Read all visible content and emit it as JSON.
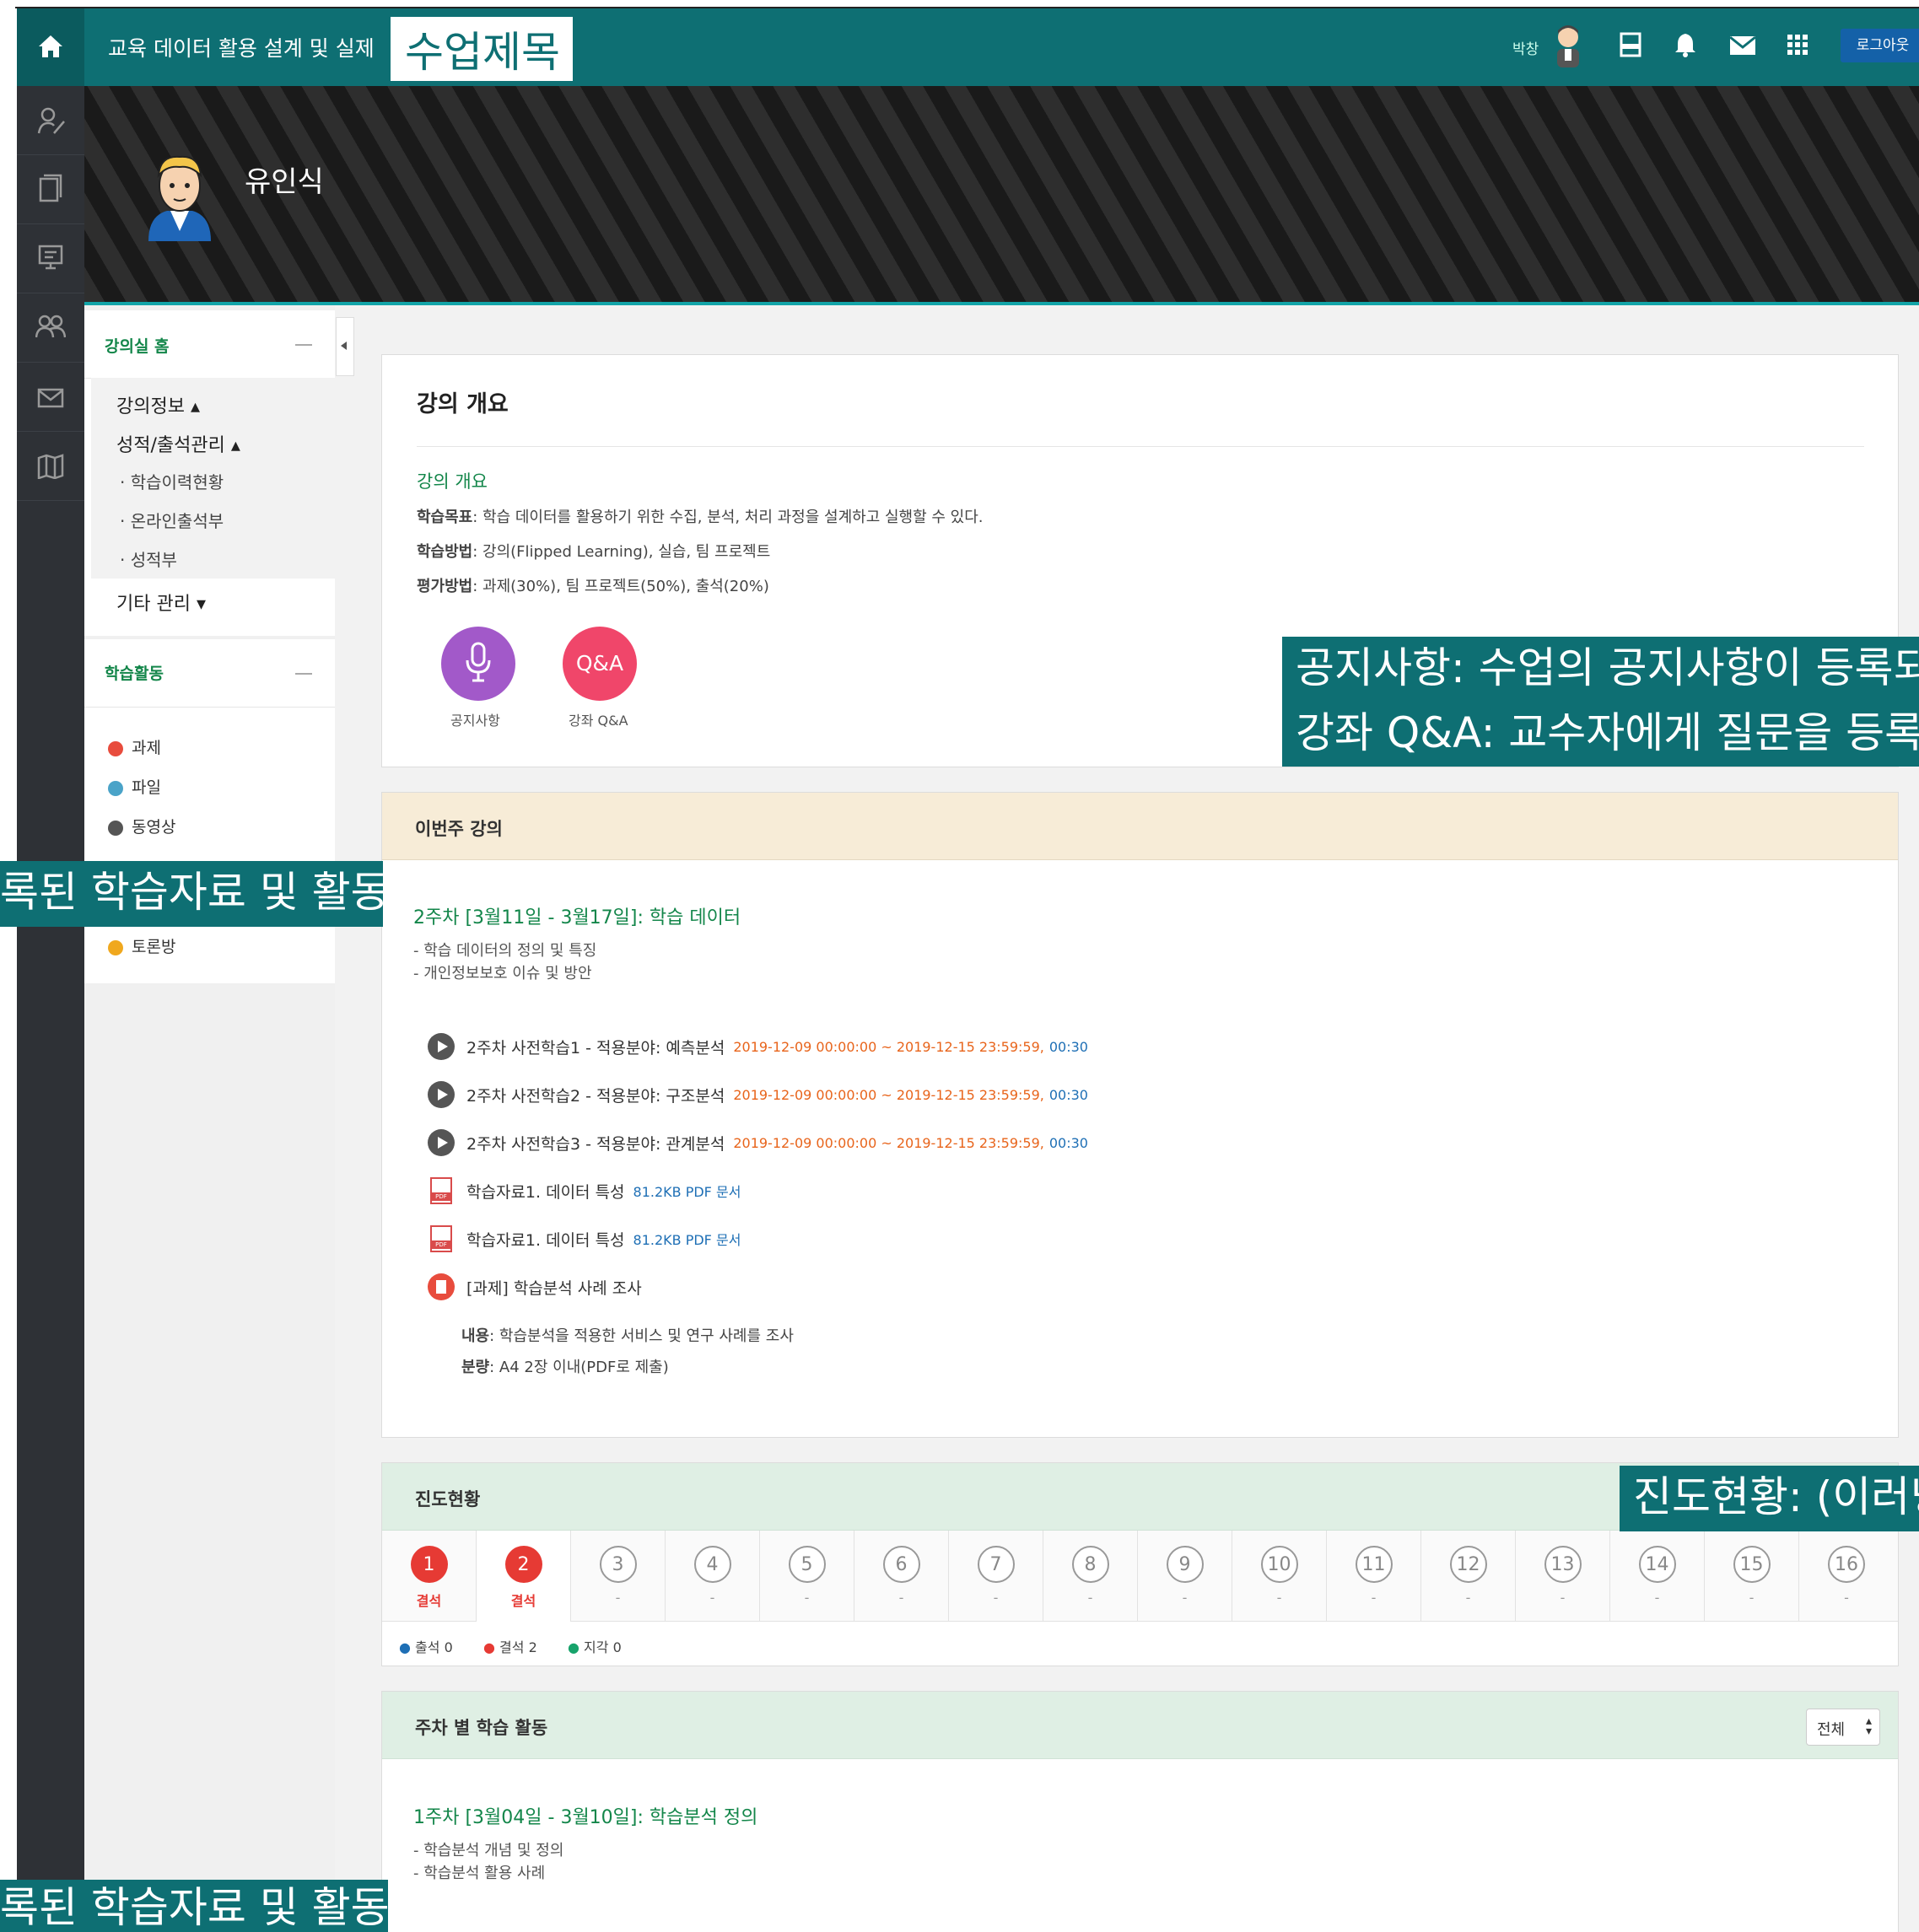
{
  "topbar": {
    "course_name": "교육 데이터 활용 설계 및 실제",
    "title_label": "수업제목",
    "user_name": "박창",
    "logout_label": "로그아웃"
  },
  "hero": {
    "professor_name": "유인식"
  },
  "sidebar": {
    "home_label": "강의실 홈",
    "menu": [
      {
        "label": "강의정보 ▴"
      },
      {
        "label": "성적/출석관리 ▴"
      },
      {
        "label": "· 학습이력현황"
      },
      {
        "label": "· 온라인출석부"
      },
      {
        "label": "· 성적부"
      },
      {
        "label": "기타 관리 ▾"
      }
    ],
    "activities_title": "학습활동",
    "activities": [
      {
        "label": "과제",
        "color": "#e84c3d"
      },
      {
        "label": "파일",
        "color": "#4aa3c8"
      },
      {
        "label": "동영상",
        "color": "#555555"
      },
      {
        "label": "토론방",
        "color": "#f0a81e"
      }
    ]
  },
  "overview": {
    "heading": "강의 개요",
    "subheading": "강의 개요",
    "goal_key": "학습목표",
    "goal_val": ": 학습 데이터를 활용하기 위한 수집, 분석, 처리 과정을 설계하고 실행할 수 있다.",
    "method_key": "학습방법",
    "method_val": ": 강의(Flipped Learning), 실습, 팀 프로젝트",
    "eval_key": "평가방법",
    "eval_val": ": 과제(30%), 팀 프로젝트(50%), 출석(20%)",
    "notice_label": "공지사항",
    "qa_icon_text": "Q&A",
    "qa_label": "강좌 Q&A"
  },
  "this_week": {
    "header": "이번주 강의",
    "title": "2주차 [3월11일 - 3월17일]: 학습 데이터",
    "desc1": "- 학습 데이터의 정의 및 특징",
    "desc2": "- 개인정보보호 이슈 및 방안",
    "items": [
      {
        "name": "2주차 사전학습1 - 적용분야: 예측분석",
        "period": "2019-12-09 00:00:00 ~ 2019-12-15 23:59:59,",
        "extra": "00:30"
      },
      {
        "name": "2주차 사전학습2 - 적용분야: 구조분석",
        "period": "2019-12-09 00:00:00 ~ 2019-12-15 23:59:59,",
        "extra": "00:30"
      },
      {
        "name": "2주차 사전학습3 - 적용분야: 관계분석",
        "period": "2019-12-09 00:00:00 ~ 2019-12-15 23:59:59,",
        "extra": "00:30"
      },
      {
        "name": "학습자료1. 데이터 특성",
        "period": "",
        "extra": "81.2KB PDF 문서"
      },
      {
        "name": "학습자료1. 데이터 특성",
        "period": "",
        "extra": "81.2KB PDF 문서"
      },
      {
        "name": "[과제] 학습분석 사례 조사",
        "period": "",
        "extra": ""
      }
    ],
    "content_key": "내용",
    "content_val": ": 학습분석을 적용한 서비스 및 연구 사례를 조사",
    "amount_key": "분량",
    "amount_val": ": A4 2장 이내(PDF로 제출)"
  },
  "progress": {
    "header": "진도현황",
    "weeks": [
      {
        "num": "1",
        "status": "결석"
      },
      {
        "num": "2",
        "status": "결석"
      },
      {
        "num": "3",
        "status": "-"
      },
      {
        "num": "4",
        "status": "-"
      },
      {
        "num": "5",
        "status": "-"
      },
      {
        "num": "6",
        "status": "-"
      },
      {
        "num": "7",
        "status": "-"
      },
      {
        "num": "8",
        "status": "-"
      },
      {
        "num": "9",
        "status": "-"
      },
      {
        "num": "10",
        "status": "-"
      },
      {
        "num": "11",
        "status": "-"
      },
      {
        "num": "12",
        "status": "-"
      },
      {
        "num": "13",
        "status": "-"
      },
      {
        "num": "14",
        "status": "-"
      },
      {
        "num": "15",
        "status": "-"
      },
      {
        "num": "16",
        "status": "-"
      }
    ],
    "legend_attend": "출석 0",
    "legend_absent": "결석 2",
    "legend_late": "지각 0"
  },
  "weekly": {
    "header": "주차 별 학습 활동",
    "select_value": "전체",
    "week1_title": "1주차 [3월04일 - 3월10일]: 학습분석 정의",
    "week1_desc1": "- 학습분석 개념 및 정의",
    "week1_desc2": "- 학습분석 활용 사례"
  },
  "annotations": {
    "notice": "공지사항: 수업의 공지사항이 등록되",
    "qa": "강좌 Q&A: 교수자에게 질문을 등록히",
    "activities": "록된 학습자료 및 활동",
    "progress": "진도현황: (이러닝",
    "bottom": "록된 학습자료 및 활동"
  },
  "colors": {
    "teal": "#0e6f73",
    "green_link": "#13864a",
    "orange": "#e8641b",
    "red": "#e63a34",
    "purple": "#a259c9",
    "pink": "#f0466a"
  }
}
